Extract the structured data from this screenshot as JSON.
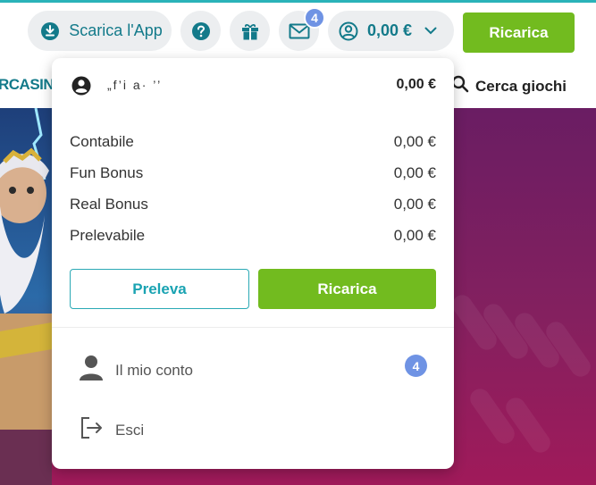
{
  "header": {
    "app_label": "Scarica l'App",
    "mail_badge": "4",
    "balance": "0,00 €",
    "ricarica_label": "Ricarica"
  },
  "nav": {
    "casino_label": "RCASINO",
    "search_label": "Cerca giochi"
  },
  "account_menu": {
    "username": "„f’i  a·   ’’",
    "balance": "0,00 €",
    "rows": [
      {
        "label": "Contabile",
        "value": "0,00 €"
      },
      {
        "label": "Fun Bonus",
        "value": "0,00 €"
      },
      {
        "label": "Real Bonus",
        "value": "0,00 €"
      },
      {
        "label": "Prelevabile",
        "value": "0,00 €"
      }
    ],
    "preleva_label": "Preleva",
    "ricarica_label": "Ricarica",
    "my_account_label": "Il mio conto",
    "my_account_badge": "4",
    "logout_label": "Esci"
  },
  "icons": {
    "download": "download-icon",
    "help": "question-icon",
    "gift": "gift-icon",
    "mail": "mail-icon",
    "user": "user-circle-icon",
    "chevron": "chevron-down-icon",
    "search": "search-icon",
    "person": "person-icon",
    "logout": "logout-icon"
  },
  "colors": {
    "brand_teal": "#137a8a",
    "accent_green": "#72bb1f",
    "badge_blue": "#6f93e4",
    "hero_purple": "#84205f"
  }
}
